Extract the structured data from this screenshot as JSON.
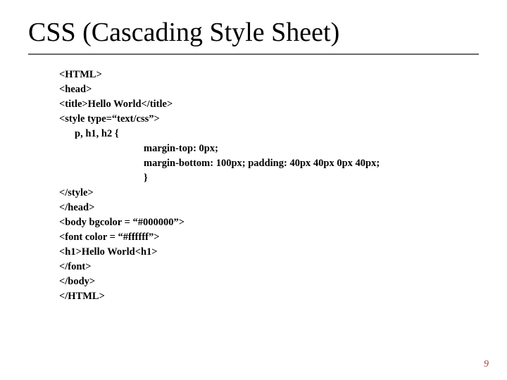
{
  "title": "CSS (Cascading Style Sheet)",
  "code": {
    "l1": "<HTML>",
    "l2": "<head>",
    "l3": "<title>Hello World</title>",
    "l4": "<style type=“text/css”>",
    "l5": "p, h1, h2 {",
    "l6": "margin-top: 0px;",
    "l7": "margin-bottom: 100px; padding: 40px 40px 0px 40px;",
    "l8": "}",
    "l9": "</style>",
    "l10": "</head>",
    "l11": "<body bgcolor = “#000000”>",
    "l12": "<font color = “#ffffff”>",
    "l13": "<h1>Hello World<h1>",
    "l14": "</font>",
    "l15": "</body>",
    "l16": "</HTML>"
  },
  "page_number": "9"
}
